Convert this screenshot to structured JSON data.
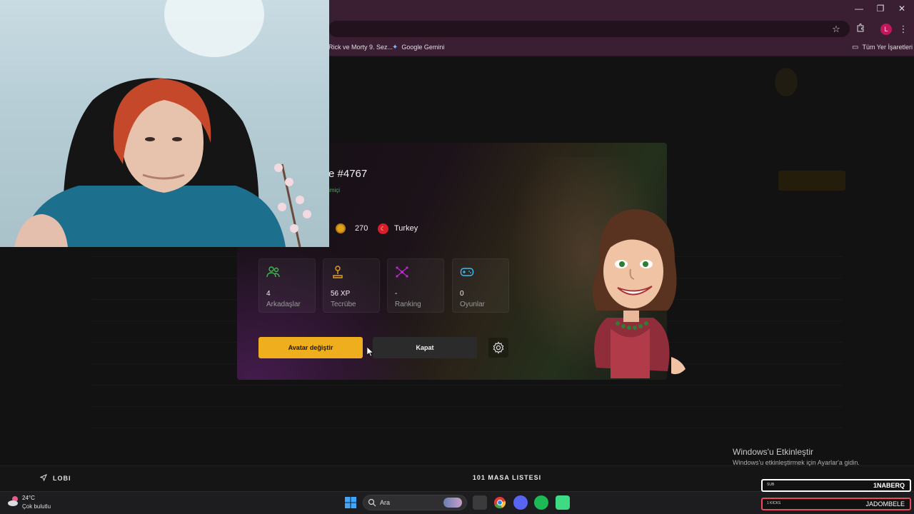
{
  "browser": {
    "bookmarks": [
      {
        "label": "Rick ve Morty 9. Sez..."
      },
      {
        "label": "Google Gemini",
        "icon": "gemini-icon"
      }
    ],
    "all_bookmarks_label": "Tüm Yer İşaretleri",
    "profile_initial": "L",
    "window_controls": [
      "—",
      "❐",
      "✕"
    ]
  },
  "profile_modal": {
    "username": "e #4767",
    "status": "imiçi",
    "coins": "270",
    "country": "Turkey",
    "stats": [
      {
        "value": "4",
        "label": "Arkadaşlar",
        "icon": "friends-icon",
        "color": "#3fb950"
      },
      {
        "value": "56 XP",
        "label": "Tecrübe",
        "icon": "experience-icon",
        "color": "#e0a21a"
      },
      {
        "value": "-",
        "label": "Ranking",
        "icon": "ranking-icon",
        "color": "#c026d3"
      },
      {
        "value": "0",
        "label": "Oyunlar",
        "icon": "gamepad-icon",
        "color": "#38bdf8"
      }
    ],
    "change_avatar_label": "Avatar değiştir",
    "close_label": "Kapat"
  },
  "bottom_bar": {
    "lobby_label": "LOBI",
    "table_list_label": "101 MASA LISTESI"
  },
  "activation_watermark": {
    "title": "Windows'u Etkinleştir",
    "subtitle": "Windows'u etkinleştirmek için Ayarlar'a gidin."
  },
  "taskbar": {
    "weather_temp": "24°C",
    "weather_desc": "Çok bulutlu",
    "search_placeholder": "Ara"
  },
  "stream_overlays": [
    {
      "tag": "SUB",
      "name": "1NABERQ"
    },
    {
      "tag": "1 KICKS",
      "name": "JADOMBELE"
    }
  ],
  "colors": {
    "accent_yellow": "#efae1d",
    "chrome_purple": "#3a1f33"
  }
}
